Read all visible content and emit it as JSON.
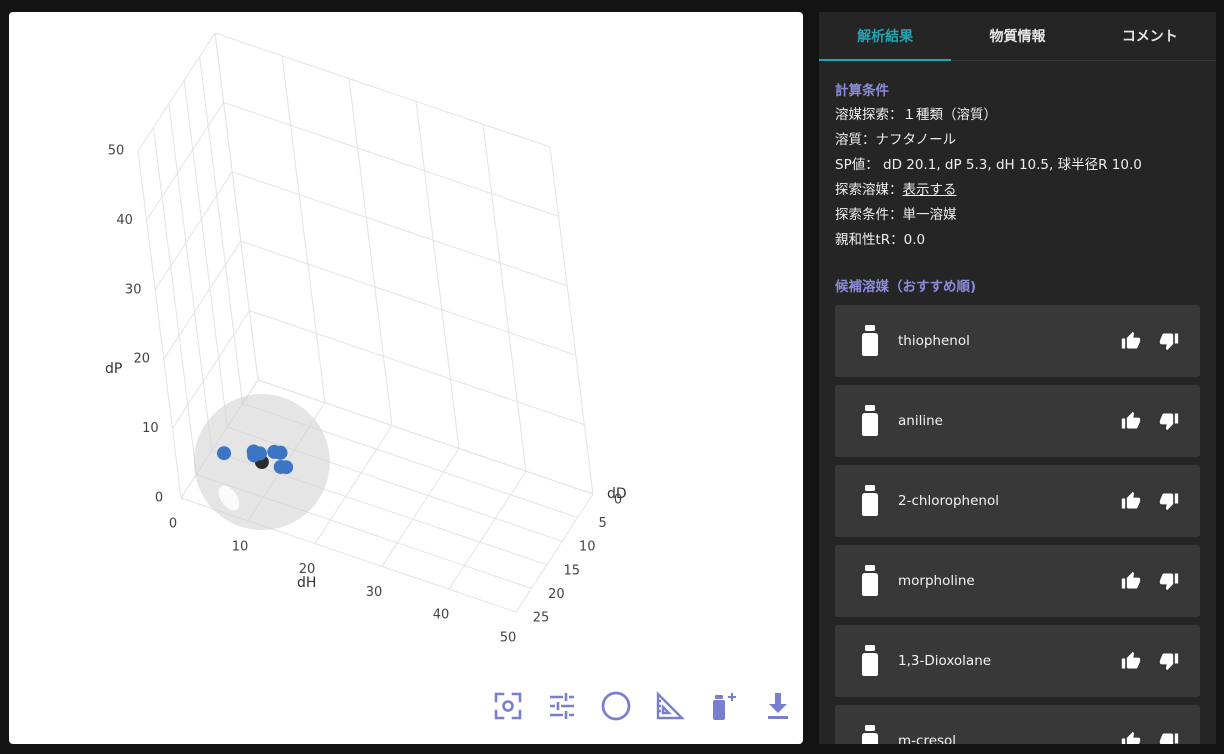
{
  "plot": {
    "axes": {
      "dP": {
        "title": "dP",
        "ticks": [
          "0",
          "10",
          "20",
          "30",
          "40",
          "50"
        ]
      },
      "dH": {
        "title": "dH",
        "ticks": [
          "0",
          "10",
          "20",
          "30",
          "40",
          "50"
        ]
      },
      "dD": {
        "title": "dD",
        "ticks": [
          "0",
          "5",
          "10",
          "15",
          "20",
          "25"
        ]
      }
    },
    "point_color": "#3b75c4",
    "toolbar": {
      "icons": [
        "focus-icon",
        "tune-icon",
        "circle-icon",
        "ruler-icon",
        "add-bottle-icon",
        "download-icon"
      ],
      "icon_color": "#7a7ed1"
    }
  },
  "chart_data": {
    "type": "scatter3d",
    "axes": {
      "x": "dH",
      "y": "dD",
      "z": "dP"
    },
    "axis_ranges": {
      "dH": [
        0,
        50
      ],
      "dD": [
        0,
        25
      ],
      "dP": [
        0,
        50
      ]
    },
    "sphere": {
      "center": {
        "dD": 20.1,
        "dP": 5.3,
        "dH": 10.5
      },
      "radius": 10.0
    },
    "points": [
      {
        "dH": 8.5,
        "dD": 18.5,
        "dP": 4.5
      },
      {
        "dH": 8.0,
        "dD": 17.6,
        "dP": 4.3
      },
      {
        "dH": 3.0,
        "dD": 17.0,
        "dP": 2.0
      },
      {
        "dH": 9.5,
        "dD": 18.6,
        "dP": 5.2
      },
      {
        "dH": 12.0,
        "dD": 19.0,
        "dP": 6.5
      },
      {
        "dH": 12.5,
        "dD": 18.2,
        "dP": 6.0
      },
      {
        "dH": 13.0,
        "dD": 19.5,
        "dP": 5.0
      },
      {
        "dH": 14.0,
        "dD": 19.8,
        "dP": 5.5
      }
    ]
  },
  "sidebar": {
    "tabs": [
      {
        "label": "解析結果",
        "active": true
      },
      {
        "label": "物質情報",
        "active": false
      },
      {
        "label": "コメント",
        "active": false
      }
    ],
    "calc_title": "計算条件",
    "conditions": {
      "search": "溶媒探索：１種類（溶質）",
      "solute": "溶質：ナフタノール",
      "sp": "SP値： dD 20.1, dP 5.3, dH 10.5, 球半径R 10.0",
      "solvent_prefix": "探索溶媒：",
      "solvent_link": "表示する",
      "condition": "探索条件：単一溶媒",
      "affinity": "親和性tR：0.0"
    },
    "candidate_title": "候補溶媒（おすすめ順)",
    "candidates": [
      {
        "name": "thiophenol"
      },
      {
        "name": "aniline"
      },
      {
        "name": "2-chlorophenol"
      },
      {
        "name": "morpholine"
      },
      {
        "name": "1,3-Dioxolane"
      },
      {
        "name": "m-cresol"
      }
    ]
  }
}
